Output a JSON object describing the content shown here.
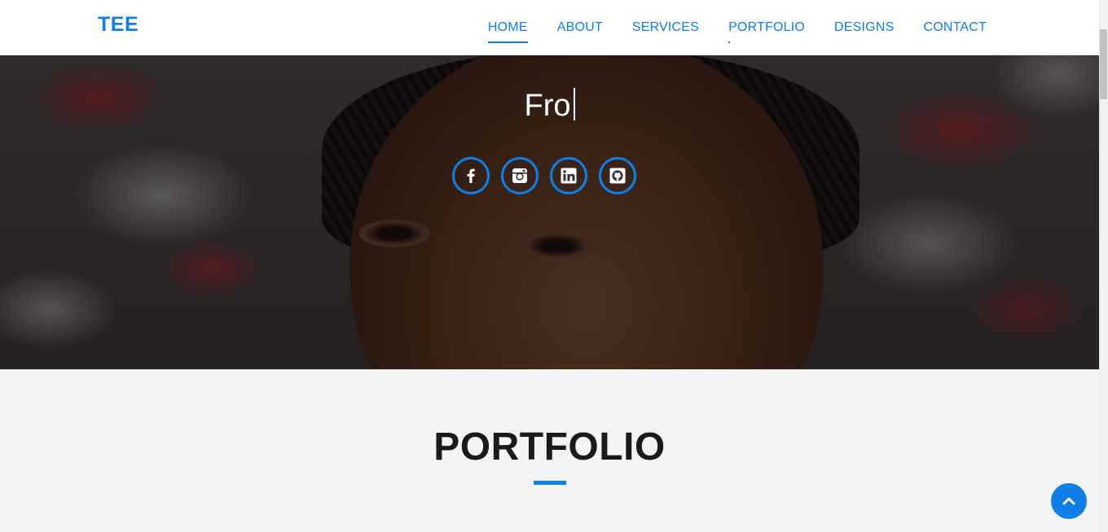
{
  "navbar": {
    "brand": "TEE",
    "items": [
      {
        "label": "HOME"
      },
      {
        "label": "ABOUT"
      },
      {
        "label": "SERVICES"
      },
      {
        "label": "PORTFOLIO"
      },
      {
        "label": "DESIGNS"
      },
      {
        "label": "CONTACT"
      }
    ],
    "active_item": "HOME"
  },
  "hero": {
    "typed_text": "Fro",
    "socials": [
      {
        "icon": "facebook-icon"
      },
      {
        "icon": "instagram-icon"
      },
      {
        "icon": "linkedin-icon"
      },
      {
        "icon": "github-icon"
      }
    ]
  },
  "portfolio": {
    "title": "PORTFOLIO"
  },
  "back_to_top": {
    "icon": "chevron-up-icon"
  },
  "colors": {
    "accent": "#0d7fe6",
    "heading": "#1a1a1a",
    "section_bg": "#f4f4f4",
    "navbar_bg": "#ffffff"
  }
}
